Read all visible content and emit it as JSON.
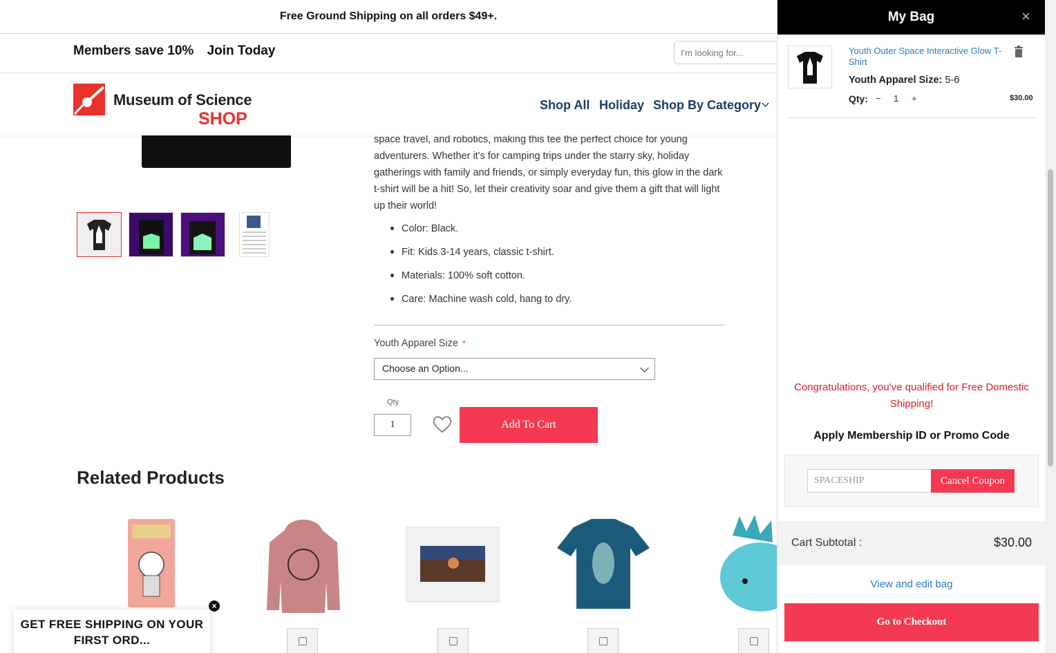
{
  "announcement": "Free Ground Shipping on all orders $49+.",
  "member_bar": {
    "save_text": "Members save 10%",
    "join_text": "Join Today"
  },
  "search": {
    "placeholder": "I'm looking for..."
  },
  "logo": {
    "line1": "Museum of Science",
    "line2": "SHOP"
  },
  "nav": {
    "items": [
      "Shop All",
      "Holiday",
      "Shop By Category"
    ]
  },
  "product": {
    "description": "space travel, and robotics, making this tee the perfect choice for young adventurers. Whether it's for camping trips under the starry sky, holiday gatherings with family and friends, or simply everyday fun, this glow in the dark t-shirt will be a hit! So, let their creativity soar and give them a gift that will light up their world!",
    "bullets": [
      "Color: Black.",
      "Fit: Kids 3-14 years, classic t-shirt.",
      "Materials: 100% soft cotton.",
      "Care: Machine wash cold, hang to dry."
    ],
    "size_label": "Youth Apparel Size",
    "size_required_mark": "*",
    "size_select": "Choose an Option...",
    "qty_label": "Qty",
    "qty_value": "1",
    "add_to_cart": "Add To Cart"
  },
  "related": {
    "title": "Related Products"
  },
  "promo": {
    "text": "GET FREE SHIPPING ON YOUR FIRST ORD...",
    "close": "×"
  },
  "bag": {
    "title": "My Bag",
    "close": "×",
    "item": {
      "name": "Youth Outer Space Interactive Glow T-Shirt",
      "size_label": "Youth Apparel Size:",
      "size_value": "5-6",
      "qty_label": "Qty:",
      "minus": "−",
      "qty": "1",
      "plus": "+",
      "price": "$30.00"
    },
    "congrats": "Congratulations, you've qualified for Free Domestic Shipping!",
    "apply_title": "Apply Membership ID or Promo Code",
    "coupon_value": "SPACESHIP",
    "cancel_coupon": "Cancel Coupon",
    "subtotal_label": "Cart Subtotal :",
    "subtotal_value": "$30.00",
    "view_edit": "View and edit bag",
    "checkout": "Go to Checkout"
  },
  "colors": {
    "accent": "#f43a52",
    "brand_red": "#e8322b",
    "nav_blue": "#1a3d66",
    "link_blue": "#2a7bc4"
  }
}
